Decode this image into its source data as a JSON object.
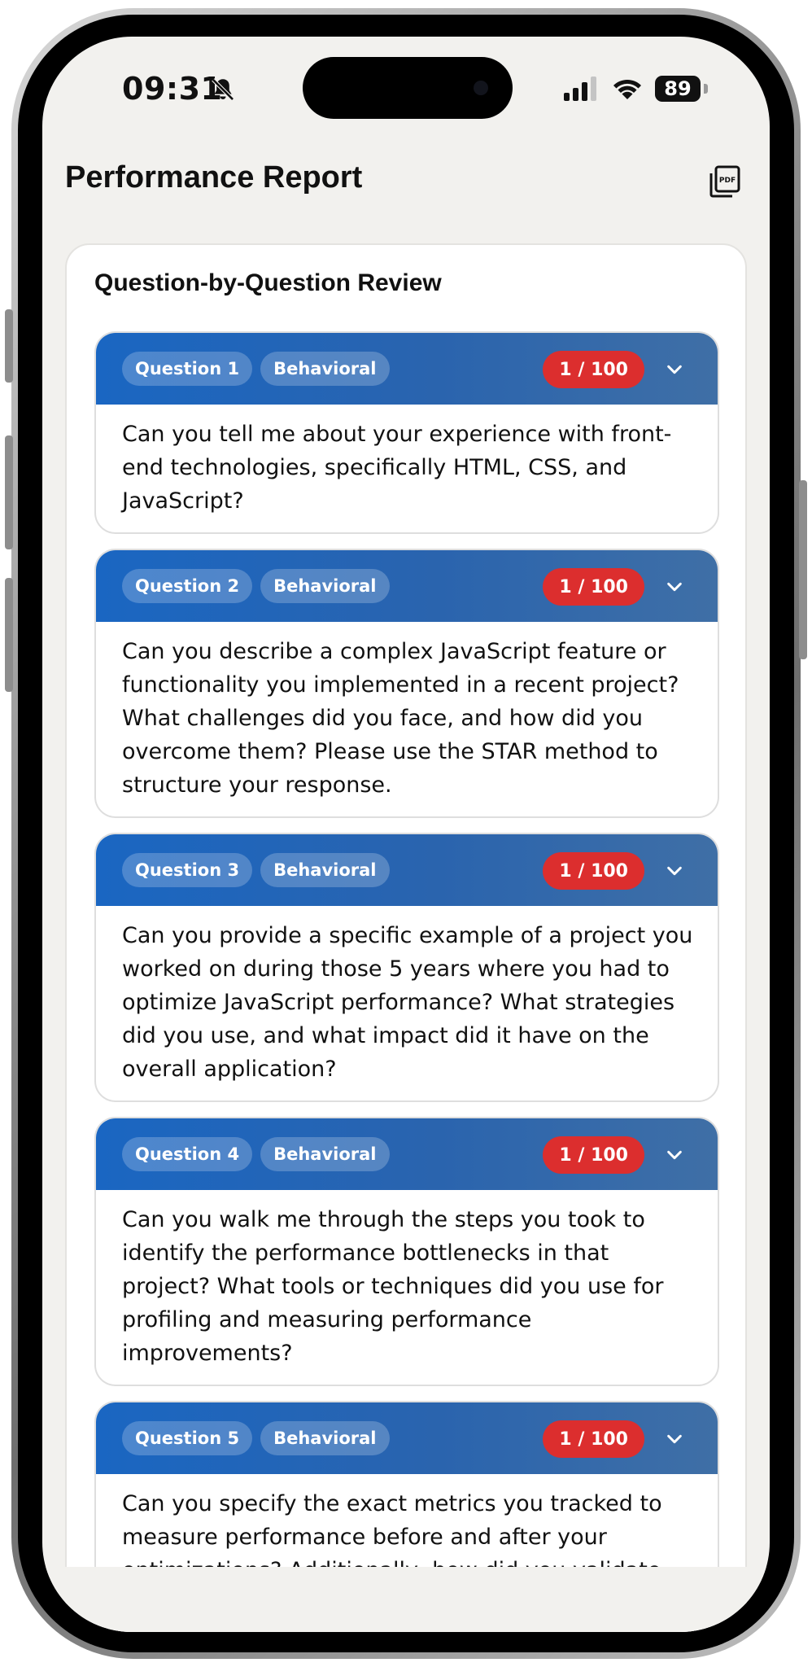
{
  "status_bar": {
    "time": "09:31",
    "battery": "89",
    "icons": [
      "bell-muted-icon",
      "signal-icon",
      "wifi-icon",
      "battery-icon"
    ]
  },
  "header": {
    "title": "Performance Report",
    "pdf_icon": "pdf-file-icon",
    "pdf_label": "PDF"
  },
  "review": {
    "title": "Question-by-Question Review",
    "questions": [
      {
        "number_label": "Question 1",
        "category": "Behavioral",
        "score": "1 / 100",
        "text": "Can you tell me about your experience with front-end technologies, specifically HTML, CSS, and JavaScript?"
      },
      {
        "number_label": "Question 2",
        "category": "Behavioral",
        "score": "1 / 100",
        "text": "Can you describe a complex JavaScript feature or functionality you implemented in a recent project? What challenges did you face, and how did you overcome them? Please use the STAR method to structure your response."
      },
      {
        "number_label": "Question 3",
        "category": "Behavioral",
        "score": "1 / 100",
        "text": "Can you provide a specific example of a project you worked on during those 5 years where you had to optimize JavaScript performance? What strategies did you use, and what impact did it have on the overall application?"
      },
      {
        "number_label": "Question 4",
        "category": "Behavioral",
        "score": "1 / 100",
        "text": "Can you walk me through the steps you took to identify the performance bottlenecks in that project? What tools or techniques did you use for profiling and measuring performance improvements?"
      },
      {
        "number_label": "Question 5",
        "category": "Behavioral",
        "score": "1 / 100",
        "text": "Can you specify the exact metrics you tracked to measure performance before and after your optimizations? Additionally, how did you validate"
      }
    ]
  },
  "colors": {
    "header_gradient_start": "#1a66c2",
    "header_gradient_end": "#3f6fa6",
    "score_badge": "#dc2e2e",
    "screen_background": "#f2f1ee"
  }
}
